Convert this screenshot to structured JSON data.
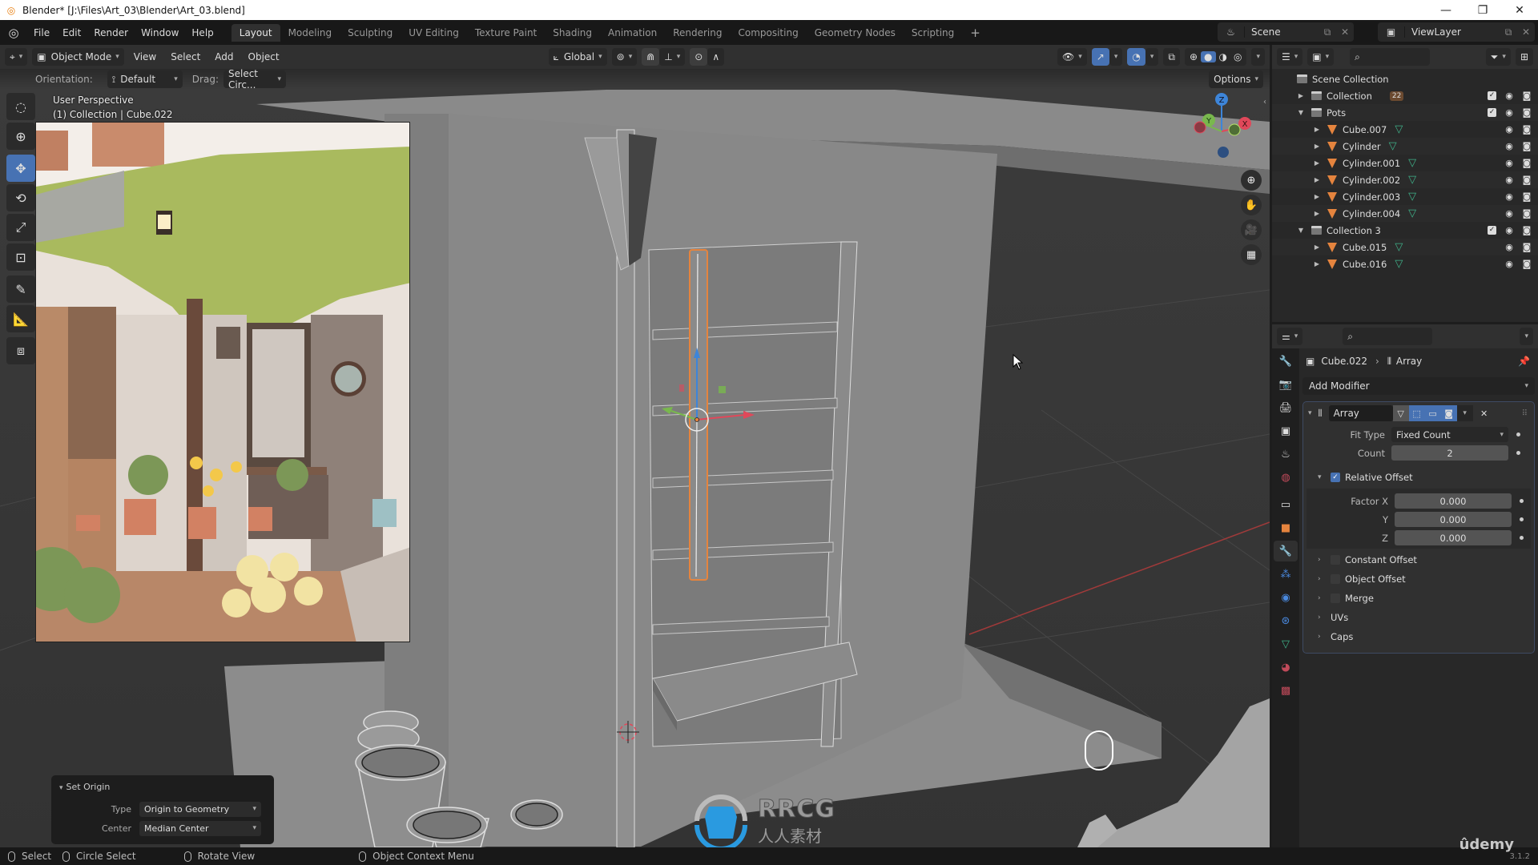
{
  "window": {
    "title": "Blender* [J:\\Files\\Art_03\\Blender\\Art_03.blend]",
    "controls": [
      "minimize",
      "maximize",
      "close"
    ]
  },
  "menu": [
    "File",
    "Edit",
    "Render",
    "Window",
    "Help"
  ],
  "workspaces": [
    {
      "label": "Layout",
      "active": true
    },
    {
      "label": "Modeling"
    },
    {
      "label": "Sculpting"
    },
    {
      "label": "UV Editing"
    },
    {
      "label": "Texture Paint"
    },
    {
      "label": "Shading"
    },
    {
      "label": "Animation"
    },
    {
      "label": "Rendering"
    },
    {
      "label": "Compositing"
    },
    {
      "label": "Geometry Nodes"
    },
    {
      "label": "Scripting"
    }
  ],
  "add_workspace": "+",
  "scene": {
    "label": "Scene"
  },
  "view_layer": {
    "label": "ViewLayer"
  },
  "viewport_header": {
    "mode": "Object Mode",
    "menus": [
      "View",
      "Select",
      "Add",
      "Object"
    ],
    "transform_orientation": "Global",
    "options": "Options"
  },
  "tool_settings": {
    "orientation_label": "Orientation:",
    "orientation_value": "Default",
    "drag_label": "Drag:",
    "drag_value": "Select Circ..."
  },
  "viewport": {
    "view_name": "User Perspective",
    "context": "(1) Collection | Cube.022",
    "gizmo_axes": [
      "X",
      "Y",
      "Z"
    ]
  },
  "tools": [
    {
      "name": "select-circle",
      "active": false
    },
    {
      "name": "cursor",
      "active": false
    },
    {
      "name": "move",
      "active": true
    },
    {
      "name": "rotate",
      "active": false
    },
    {
      "name": "scale",
      "active": false
    },
    {
      "name": "transform",
      "active": false
    },
    {
      "name": "annotate",
      "active": false
    },
    {
      "name": "measure",
      "active": false
    },
    {
      "name": "add-cube",
      "active": false
    }
  ],
  "last_operator": {
    "title": "Set Origin",
    "type_label": "Type",
    "type_value": "Origin to Geometry",
    "center_label": "Center",
    "center_value": "Median Center"
  },
  "outliner": {
    "root": "Scene Collection",
    "rows": [
      {
        "name": "Collection",
        "kind": "collection",
        "depth": 0,
        "expanded": false,
        "badge": "22",
        "checkbox": true
      },
      {
        "name": "Pots",
        "kind": "collection",
        "depth": 0,
        "expanded": true,
        "checkbox": true
      },
      {
        "name": "Cube.007",
        "kind": "mesh",
        "depth": 1
      },
      {
        "name": "Cylinder",
        "kind": "mesh",
        "depth": 1
      },
      {
        "name": "Cylinder.001",
        "kind": "mesh",
        "depth": 1
      },
      {
        "name": "Cylinder.002",
        "kind": "mesh",
        "depth": 1
      },
      {
        "name": "Cylinder.003",
        "kind": "mesh",
        "depth": 1
      },
      {
        "name": "Cylinder.004",
        "kind": "mesh",
        "depth": 1
      },
      {
        "name": "Collection 3",
        "kind": "collection",
        "depth": 0,
        "expanded": true,
        "checkbox": true
      },
      {
        "name": "Cube.015",
        "kind": "mesh",
        "depth": 1
      },
      {
        "name": "Cube.016",
        "kind": "mesh",
        "depth": 1
      }
    ]
  },
  "properties": {
    "breadcrumb_object": "Cube.022",
    "breadcrumb_modifier": "Array",
    "add_modifier": "Add Modifier",
    "tabs": [
      "tool",
      "render",
      "output",
      "view-layer",
      "scene",
      "world",
      "collection",
      "object",
      "modifiers",
      "particles",
      "physics",
      "constraints",
      "data",
      "material",
      "texture"
    ],
    "active_tab": "modifiers",
    "modifier": {
      "name": "Array",
      "fit_type_label": "Fit Type",
      "fit_type": "Fixed Count",
      "count_label": "Count",
      "count": "2",
      "relative_offset_label": "Relative Offset",
      "relative_offset_enabled": true,
      "factor_x_label": "Factor X",
      "factor_x": "0.000",
      "y_label": "Y",
      "factor_y": "0.000",
      "z_label": "Z",
      "factor_z": "0.000",
      "subpanels": [
        {
          "label": "Constant Offset",
          "checkbox": true,
          "enabled": false
        },
        {
          "label": "Object Offset",
          "checkbox": true,
          "enabled": false
        },
        {
          "label": "Merge",
          "checkbox": true,
          "enabled": false
        },
        {
          "label": "UVs",
          "checkbox": false
        },
        {
          "label": "Caps",
          "checkbox": false
        }
      ]
    }
  },
  "statusbar": {
    "left_click": "Select",
    "left_drag": "Circle Select",
    "middle": "Rotate View",
    "right": "Object Context Menu",
    "version": "3.1.2"
  },
  "watermarks": {
    "rrcg": "RRCG",
    "rrcg_cn": "人人素材",
    "udemy": "ûdemy"
  },
  "colors": {
    "accent_blue": "#4772b3",
    "selection_orange": "#e5843e",
    "axis_x": "#e0485a",
    "axis_y": "#79b84d",
    "axis_z": "#3d85d9",
    "mesh_data_green": "#3fb38a"
  }
}
